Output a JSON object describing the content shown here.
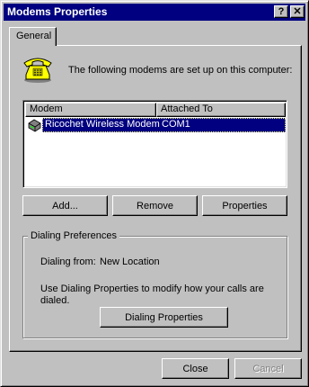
{
  "window": {
    "title": "Modems Properties",
    "help_button": "?",
    "close_button": "✕"
  },
  "tabs": [
    {
      "label": "General",
      "selected": true
    }
  ],
  "intro_text": "The following modems are set up on this computer:",
  "modem_list": {
    "columns": [
      "Modem",
      "Attached To"
    ],
    "rows": [
      {
        "modem": "Ricochet Wireless Modem",
        "attached_to": "COM1",
        "selected": true,
        "icon": "modem-icon"
      }
    ]
  },
  "buttons": {
    "add": "Add...",
    "remove": "Remove",
    "properties": "Properties",
    "dialing_properties": "Dialing Properties",
    "close": "Close",
    "cancel": "Cancel"
  },
  "dialing_preferences": {
    "group_label": "Dialing Preferences",
    "dialing_from_label": "Dialing from:",
    "dialing_from_value": "New Location",
    "info_text": "Use Dialing Properties to modify how your calls are dialed."
  },
  "colors": {
    "title_bar": "#000080",
    "face": "#c0c0c0",
    "selection": "#000080"
  }
}
